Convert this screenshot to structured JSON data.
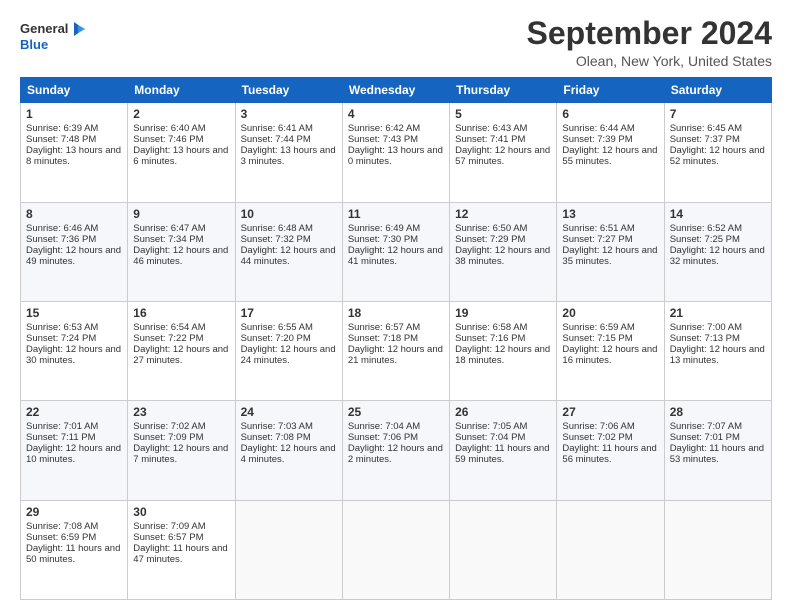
{
  "logo": {
    "line1": "General",
    "line2": "Blue"
  },
  "title": "September 2024",
  "location": "Olean, New York, United States",
  "weekdays": [
    "Sunday",
    "Monday",
    "Tuesday",
    "Wednesday",
    "Thursday",
    "Friday",
    "Saturday"
  ],
  "weeks": [
    [
      {
        "day": "1",
        "sunrise": "6:39 AM",
        "sunset": "7:48 PM",
        "daylight": "13 hours and 8 minutes."
      },
      {
        "day": "2",
        "sunrise": "6:40 AM",
        "sunset": "7:46 PM",
        "daylight": "13 hours and 6 minutes."
      },
      {
        "day": "3",
        "sunrise": "6:41 AM",
        "sunset": "7:44 PM",
        "daylight": "13 hours and 3 minutes."
      },
      {
        "day": "4",
        "sunrise": "6:42 AM",
        "sunset": "7:43 PM",
        "daylight": "13 hours and 0 minutes."
      },
      {
        "day": "5",
        "sunrise": "6:43 AM",
        "sunset": "7:41 PM",
        "daylight": "12 hours and 57 minutes."
      },
      {
        "day": "6",
        "sunrise": "6:44 AM",
        "sunset": "7:39 PM",
        "daylight": "12 hours and 55 minutes."
      },
      {
        "day": "7",
        "sunrise": "6:45 AM",
        "sunset": "7:37 PM",
        "daylight": "12 hours and 52 minutes."
      }
    ],
    [
      {
        "day": "8",
        "sunrise": "6:46 AM",
        "sunset": "7:36 PM",
        "daylight": "12 hours and 49 minutes."
      },
      {
        "day": "9",
        "sunrise": "6:47 AM",
        "sunset": "7:34 PM",
        "daylight": "12 hours and 46 minutes."
      },
      {
        "day": "10",
        "sunrise": "6:48 AM",
        "sunset": "7:32 PM",
        "daylight": "12 hours and 44 minutes."
      },
      {
        "day": "11",
        "sunrise": "6:49 AM",
        "sunset": "7:30 PM",
        "daylight": "12 hours and 41 minutes."
      },
      {
        "day": "12",
        "sunrise": "6:50 AM",
        "sunset": "7:29 PM",
        "daylight": "12 hours and 38 minutes."
      },
      {
        "day": "13",
        "sunrise": "6:51 AM",
        "sunset": "7:27 PM",
        "daylight": "12 hours and 35 minutes."
      },
      {
        "day": "14",
        "sunrise": "6:52 AM",
        "sunset": "7:25 PM",
        "daylight": "12 hours and 32 minutes."
      }
    ],
    [
      {
        "day": "15",
        "sunrise": "6:53 AM",
        "sunset": "7:24 PM",
        "daylight": "12 hours and 30 minutes."
      },
      {
        "day": "16",
        "sunrise": "6:54 AM",
        "sunset": "7:22 PM",
        "daylight": "12 hours and 27 minutes."
      },
      {
        "day": "17",
        "sunrise": "6:55 AM",
        "sunset": "7:20 PM",
        "daylight": "12 hours and 24 minutes."
      },
      {
        "day": "18",
        "sunrise": "6:57 AM",
        "sunset": "7:18 PM",
        "daylight": "12 hours and 21 minutes."
      },
      {
        "day": "19",
        "sunrise": "6:58 AM",
        "sunset": "7:16 PM",
        "daylight": "12 hours and 18 minutes."
      },
      {
        "day": "20",
        "sunrise": "6:59 AM",
        "sunset": "7:15 PM",
        "daylight": "12 hours and 16 minutes."
      },
      {
        "day": "21",
        "sunrise": "7:00 AM",
        "sunset": "7:13 PM",
        "daylight": "12 hours and 13 minutes."
      }
    ],
    [
      {
        "day": "22",
        "sunrise": "7:01 AM",
        "sunset": "7:11 PM",
        "daylight": "12 hours and 10 minutes."
      },
      {
        "day": "23",
        "sunrise": "7:02 AM",
        "sunset": "7:09 PM",
        "daylight": "12 hours and 7 minutes."
      },
      {
        "day": "24",
        "sunrise": "7:03 AM",
        "sunset": "7:08 PM",
        "daylight": "12 hours and 4 minutes."
      },
      {
        "day": "25",
        "sunrise": "7:04 AM",
        "sunset": "7:06 PM",
        "daylight": "12 hours and 2 minutes."
      },
      {
        "day": "26",
        "sunrise": "7:05 AM",
        "sunset": "7:04 PM",
        "daylight": "11 hours and 59 minutes."
      },
      {
        "day": "27",
        "sunrise": "7:06 AM",
        "sunset": "7:02 PM",
        "daylight": "11 hours and 56 minutes."
      },
      {
        "day": "28",
        "sunrise": "7:07 AM",
        "sunset": "7:01 PM",
        "daylight": "11 hours and 53 minutes."
      }
    ],
    [
      {
        "day": "29",
        "sunrise": "7:08 AM",
        "sunset": "6:59 PM",
        "daylight": "11 hours and 50 minutes."
      },
      {
        "day": "30",
        "sunrise": "7:09 AM",
        "sunset": "6:57 PM",
        "daylight": "11 hours and 47 minutes."
      },
      null,
      null,
      null,
      null,
      null
    ]
  ]
}
